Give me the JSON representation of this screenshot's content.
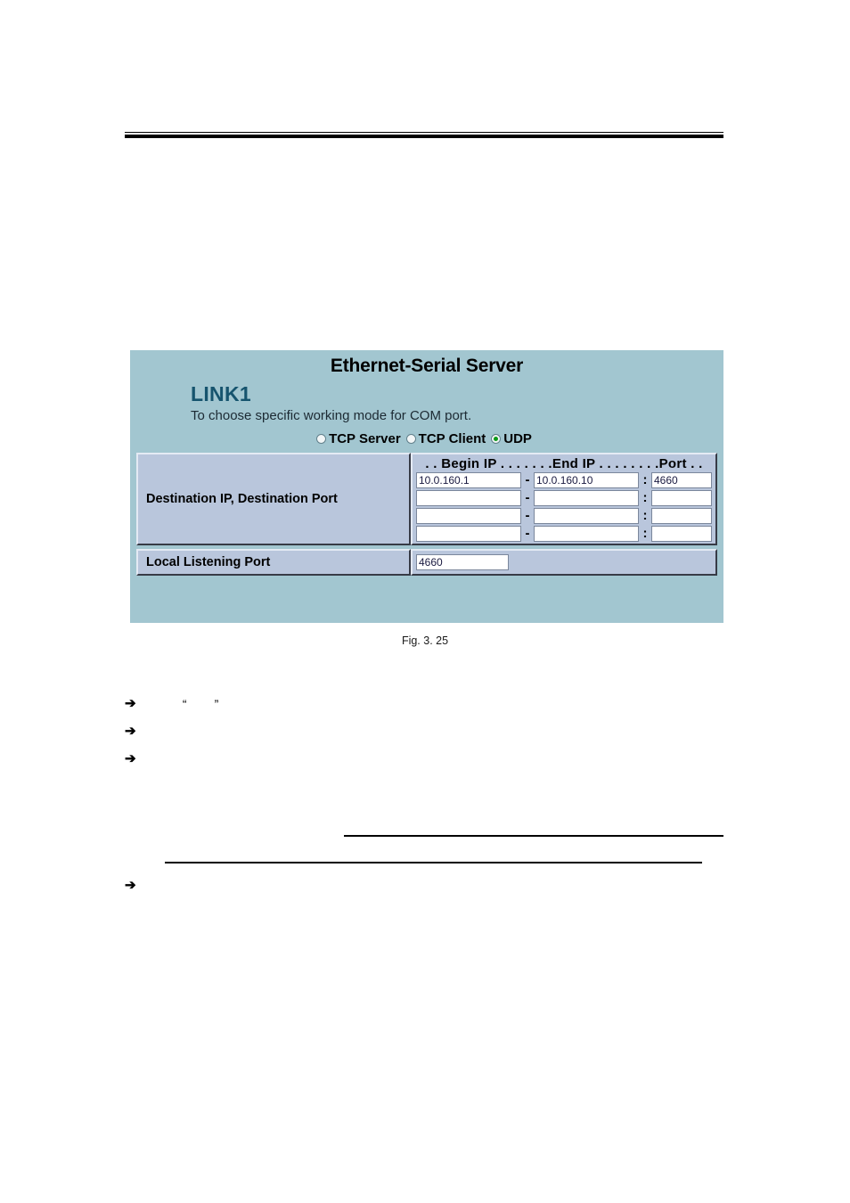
{
  "page": {
    "figure_caption": "Fig. 3. 25"
  },
  "panel": {
    "title": "Ethernet-Serial Server",
    "link_label": "LINK1",
    "description": "To choose specific working mode for COM port.",
    "mode_options": [
      {
        "label": "TCP Server",
        "selected": false
      },
      {
        "label": "TCP Client",
        "selected": false
      },
      {
        "label": "UDP",
        "selected": true
      }
    ],
    "selected_mode": "UDP",
    "accent_color": "#16546e",
    "panel_bg": "#a2c6d0",
    "cell_bg": "#b9c6dc",
    "radio_dot_color": "#0b9a18",
    "table": {
      "destination": {
        "row_label": "Destination IP, Destination Port",
        "column_header": ". . Begin IP . . . . . . .End IP . . . . . . . .Port . .",
        "header_parts": {
          "begin": "Begin IP",
          "end": "End IP",
          "port": "Port"
        },
        "separator_dash": "-",
        "separator_colon": ":",
        "rows": [
          {
            "begin_ip": "10.0.160.1",
            "end_ip": "10.0.160.10",
            "port": "4660"
          },
          {
            "begin_ip": "",
            "end_ip": "",
            "port": ""
          },
          {
            "begin_ip": "",
            "end_ip": "",
            "port": ""
          },
          {
            "begin_ip": "",
            "end_ip": "",
            "port": ""
          }
        ]
      },
      "local_listening": {
        "row_label": "Local Listening Port",
        "value": "4660"
      }
    }
  },
  "bullets": [
    {
      "arrow": "➔",
      "text": "          “        ”"
    },
    {
      "arrow": "➔",
      "text": ""
    },
    {
      "arrow": "➔",
      "text": ""
    }
  ],
  "bullet_bottom": {
    "arrow": "➔",
    "text": ""
  }
}
